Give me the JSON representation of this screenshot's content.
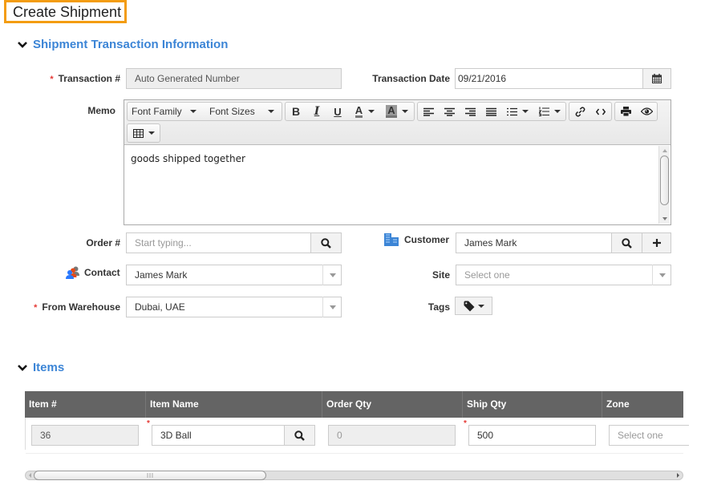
{
  "page_title": "Create Shipment",
  "sections": {
    "transaction": {
      "title": "Shipment Transaction Information"
    },
    "items": {
      "title": "Items"
    }
  },
  "form": {
    "transaction_number": {
      "label": "Transaction #",
      "value": "Auto Generated Number",
      "required": true
    },
    "transaction_date": {
      "label": "Transaction Date",
      "value": "09/21/2016"
    },
    "memo": {
      "label": "Memo",
      "content": "goods shipped together",
      "toolbar": {
        "font_family": "Font Family",
        "font_sizes": "Font Sizes",
        "bold": "B",
        "italic": "I",
        "underline": "U",
        "text_color": "A",
        "bg_color": "A"
      }
    },
    "order_number": {
      "label": "Order #",
      "placeholder": "Start typing..."
    },
    "customer": {
      "label": "Customer",
      "value": "James Mark"
    },
    "contact": {
      "label": "Contact",
      "value": "James Mark"
    },
    "site": {
      "label": "Site",
      "placeholder": "Select one"
    },
    "from_warehouse": {
      "label": "From Warehouse",
      "value": "Dubai, UAE",
      "required": true
    },
    "tags": {
      "label": "Tags"
    }
  },
  "items_table": {
    "columns": [
      "Item #",
      "Item Name",
      "Order Qty",
      "Ship Qty",
      "Zone"
    ],
    "rows": [
      {
        "item_number": "36",
        "item_name": "3D Ball",
        "order_qty": "0",
        "ship_qty": "500",
        "zone_placeholder": "Select one"
      }
    ]
  },
  "colors": {
    "accent": "#3c85d6",
    "title_border": "#f39c12",
    "required": "#e53935",
    "table_header": "#646464"
  }
}
